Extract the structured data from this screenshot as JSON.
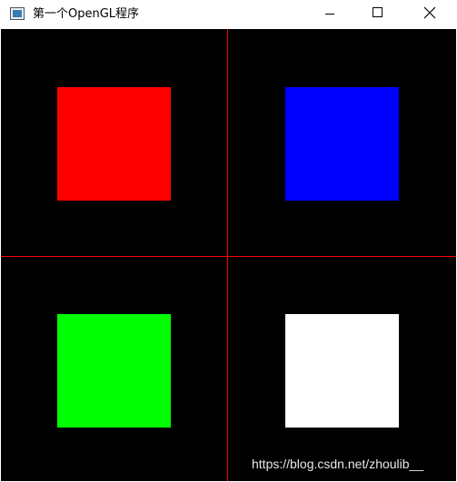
{
  "window": {
    "title": "第一个OpenGL程序"
  },
  "icons": {
    "app": "app-window-icon",
    "minimize": "minimize-icon",
    "maximize": "maximize-icon",
    "close": "close-icon"
  },
  "viewport": {
    "background": "#000000",
    "divider_color": "#ff0000",
    "quadrants": [
      {
        "position": "top-left",
        "color": "#ff0000"
      },
      {
        "position": "top-right",
        "color": "#0000ff"
      },
      {
        "position": "bottom-left",
        "color": "#00ff00"
      },
      {
        "position": "bottom-right",
        "color": "#ffffff"
      }
    ]
  },
  "watermark": "https://blog.csdn.net/zhoulib__"
}
